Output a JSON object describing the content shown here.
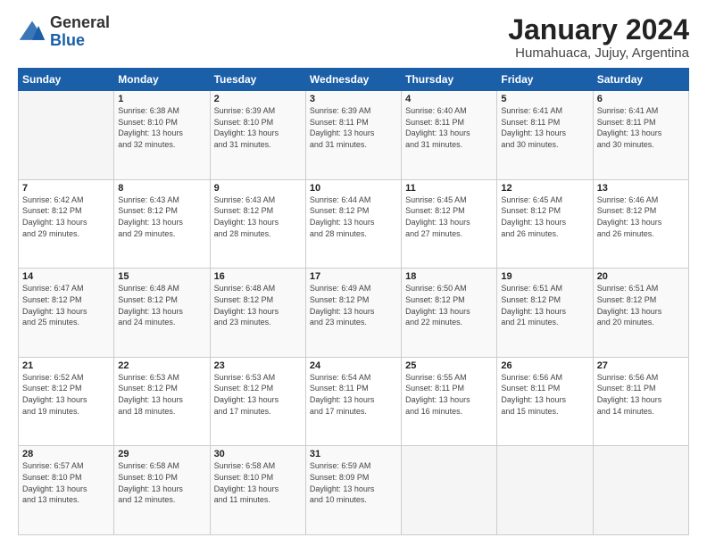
{
  "logo": {
    "general": "General",
    "blue": "Blue"
  },
  "title": "January 2024",
  "subtitle": "Humahuaca, Jujuy, Argentina",
  "days_of_week": [
    "Sunday",
    "Monday",
    "Tuesday",
    "Wednesday",
    "Thursday",
    "Friday",
    "Saturday"
  ],
  "weeks": [
    [
      {
        "day": "",
        "info": ""
      },
      {
        "day": "1",
        "info": "Sunrise: 6:38 AM\nSunset: 8:10 PM\nDaylight: 13 hours\nand 32 minutes."
      },
      {
        "day": "2",
        "info": "Sunrise: 6:39 AM\nSunset: 8:10 PM\nDaylight: 13 hours\nand 31 minutes."
      },
      {
        "day": "3",
        "info": "Sunrise: 6:39 AM\nSunset: 8:11 PM\nDaylight: 13 hours\nand 31 minutes."
      },
      {
        "day": "4",
        "info": "Sunrise: 6:40 AM\nSunset: 8:11 PM\nDaylight: 13 hours\nand 31 minutes."
      },
      {
        "day": "5",
        "info": "Sunrise: 6:41 AM\nSunset: 8:11 PM\nDaylight: 13 hours\nand 30 minutes."
      },
      {
        "day": "6",
        "info": "Sunrise: 6:41 AM\nSunset: 8:11 PM\nDaylight: 13 hours\nand 30 minutes."
      }
    ],
    [
      {
        "day": "7",
        "info": "Sunrise: 6:42 AM\nSunset: 8:12 PM\nDaylight: 13 hours\nand 29 minutes."
      },
      {
        "day": "8",
        "info": "Sunrise: 6:43 AM\nSunset: 8:12 PM\nDaylight: 13 hours\nand 29 minutes."
      },
      {
        "day": "9",
        "info": "Sunrise: 6:43 AM\nSunset: 8:12 PM\nDaylight: 13 hours\nand 28 minutes."
      },
      {
        "day": "10",
        "info": "Sunrise: 6:44 AM\nSunset: 8:12 PM\nDaylight: 13 hours\nand 28 minutes."
      },
      {
        "day": "11",
        "info": "Sunrise: 6:45 AM\nSunset: 8:12 PM\nDaylight: 13 hours\nand 27 minutes."
      },
      {
        "day": "12",
        "info": "Sunrise: 6:45 AM\nSunset: 8:12 PM\nDaylight: 13 hours\nand 26 minutes."
      },
      {
        "day": "13",
        "info": "Sunrise: 6:46 AM\nSunset: 8:12 PM\nDaylight: 13 hours\nand 26 minutes."
      }
    ],
    [
      {
        "day": "14",
        "info": "Sunrise: 6:47 AM\nSunset: 8:12 PM\nDaylight: 13 hours\nand 25 minutes."
      },
      {
        "day": "15",
        "info": "Sunrise: 6:48 AM\nSunset: 8:12 PM\nDaylight: 13 hours\nand 24 minutes."
      },
      {
        "day": "16",
        "info": "Sunrise: 6:48 AM\nSunset: 8:12 PM\nDaylight: 13 hours\nand 23 minutes."
      },
      {
        "day": "17",
        "info": "Sunrise: 6:49 AM\nSunset: 8:12 PM\nDaylight: 13 hours\nand 23 minutes."
      },
      {
        "day": "18",
        "info": "Sunrise: 6:50 AM\nSunset: 8:12 PM\nDaylight: 13 hours\nand 22 minutes."
      },
      {
        "day": "19",
        "info": "Sunrise: 6:51 AM\nSunset: 8:12 PM\nDaylight: 13 hours\nand 21 minutes."
      },
      {
        "day": "20",
        "info": "Sunrise: 6:51 AM\nSunset: 8:12 PM\nDaylight: 13 hours\nand 20 minutes."
      }
    ],
    [
      {
        "day": "21",
        "info": "Sunrise: 6:52 AM\nSunset: 8:12 PM\nDaylight: 13 hours\nand 19 minutes."
      },
      {
        "day": "22",
        "info": "Sunrise: 6:53 AM\nSunset: 8:12 PM\nDaylight: 13 hours\nand 18 minutes."
      },
      {
        "day": "23",
        "info": "Sunrise: 6:53 AM\nSunset: 8:12 PM\nDaylight: 13 hours\nand 17 minutes."
      },
      {
        "day": "24",
        "info": "Sunrise: 6:54 AM\nSunset: 8:11 PM\nDaylight: 13 hours\nand 17 minutes."
      },
      {
        "day": "25",
        "info": "Sunrise: 6:55 AM\nSunset: 8:11 PM\nDaylight: 13 hours\nand 16 minutes."
      },
      {
        "day": "26",
        "info": "Sunrise: 6:56 AM\nSunset: 8:11 PM\nDaylight: 13 hours\nand 15 minutes."
      },
      {
        "day": "27",
        "info": "Sunrise: 6:56 AM\nSunset: 8:11 PM\nDaylight: 13 hours\nand 14 minutes."
      }
    ],
    [
      {
        "day": "28",
        "info": "Sunrise: 6:57 AM\nSunset: 8:10 PM\nDaylight: 13 hours\nand 13 minutes."
      },
      {
        "day": "29",
        "info": "Sunrise: 6:58 AM\nSunset: 8:10 PM\nDaylight: 13 hours\nand 12 minutes."
      },
      {
        "day": "30",
        "info": "Sunrise: 6:58 AM\nSunset: 8:10 PM\nDaylight: 13 hours\nand 11 minutes."
      },
      {
        "day": "31",
        "info": "Sunrise: 6:59 AM\nSunset: 8:09 PM\nDaylight: 13 hours\nand 10 minutes."
      },
      {
        "day": "",
        "info": ""
      },
      {
        "day": "",
        "info": ""
      },
      {
        "day": "",
        "info": ""
      }
    ]
  ]
}
